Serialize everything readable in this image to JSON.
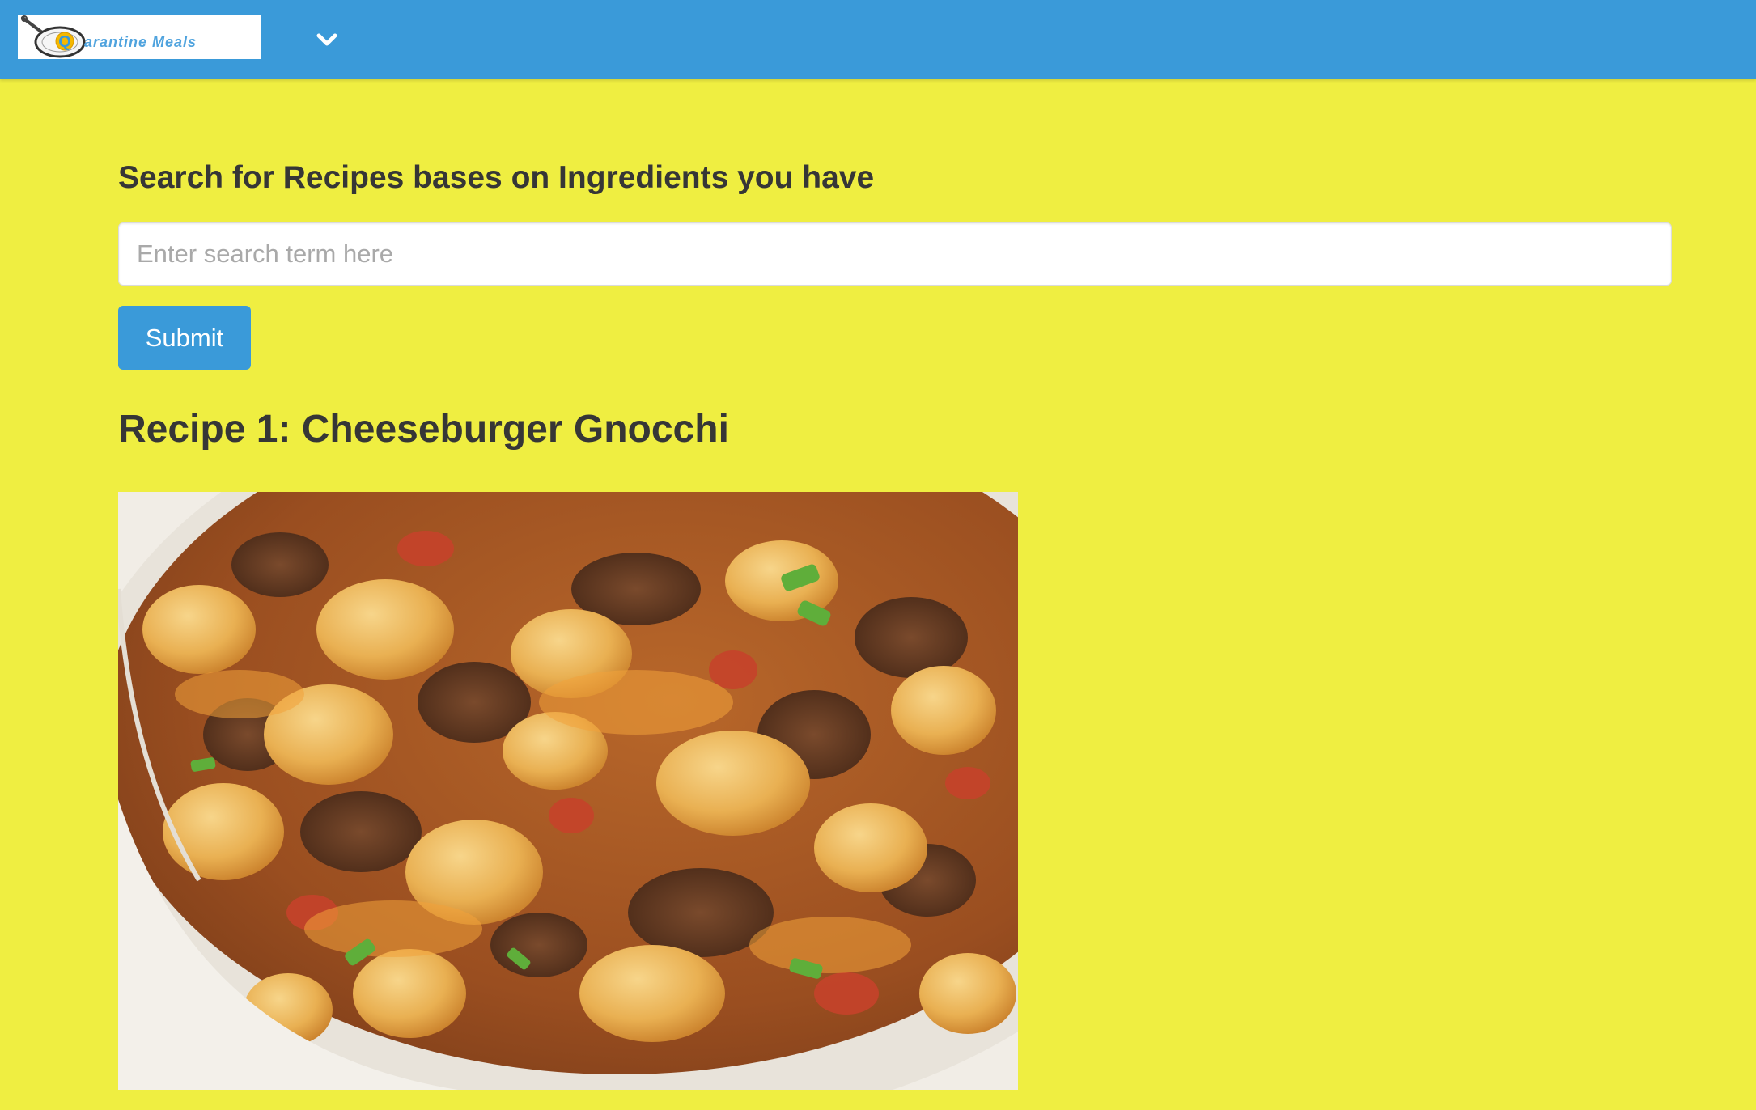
{
  "navbar": {
    "logo_text": "arantine Meals",
    "logo_letter": "Q",
    "menu_icon": "chevron-down-icon",
    "background_color": "#3A9AD9"
  },
  "search": {
    "heading": "Search for Recipes bases on Ingredients you have",
    "placeholder": "Enter search term here",
    "value": "",
    "submit_label": "Submit"
  },
  "recipes": [
    {
      "title": "Recipe 1: Cheeseburger Gnocchi",
      "image": "cheeseburger-gnocchi-photo"
    }
  ],
  "colors": {
    "page_background": "#EFEE41",
    "accent": "#3A9AD9",
    "heading_text": "#363636"
  }
}
